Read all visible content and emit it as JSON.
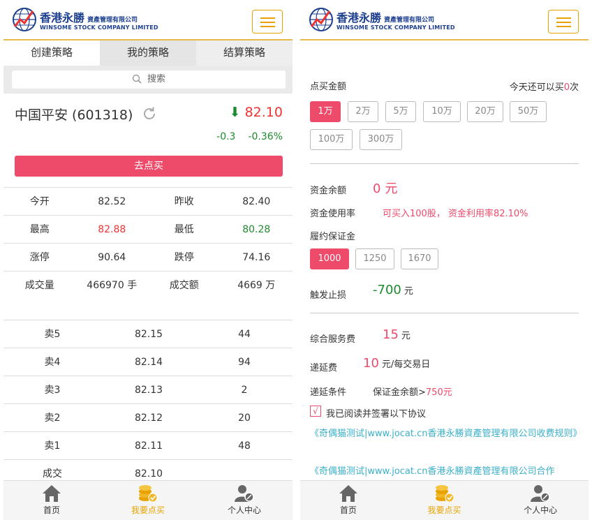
{
  "brand": {
    "name_cn": "香港永勝",
    "name_cn_sub": "資產管理有限公司",
    "name_en": "WINSOME STOCK COMPANY LIMITED"
  },
  "tabs": [
    "创建策略",
    "我的策略",
    "结算策略"
  ],
  "search": {
    "label": "搜索"
  },
  "stock": {
    "name": "中国平安 (601318)",
    "price": "82.10",
    "change": "-0.3",
    "change_pct": "-0.36%"
  },
  "buy_button": "去点买",
  "quotes": [
    [
      "今开",
      "82.52",
      "昨收",
      "82.40"
    ],
    [
      "最高",
      "82.88",
      "最低",
      "80.28"
    ],
    [
      "涨停",
      "90.64",
      "跌停",
      "74.16"
    ],
    [
      "成交量",
      "466970 手",
      "成交额",
      "4669 万"
    ]
  ],
  "orderbook": [
    [
      "卖5",
      "82.15",
      "44"
    ],
    [
      "卖4",
      "82.14",
      "94"
    ],
    [
      "卖3",
      "82.13",
      "2"
    ],
    [
      "卖2",
      "82.12",
      "20"
    ],
    [
      "卖1",
      "82.11",
      "48"
    ],
    [
      "成交",
      "82.10",
      ""
    ]
  ],
  "footer": [
    "首页",
    "我要点买",
    "个人中心"
  ],
  "order": {
    "amount_label": "点买金额",
    "today_prefix": "今天还可以买",
    "today_count": "0",
    "today_suffix": "次",
    "amounts": [
      "1万",
      "2万",
      "5万",
      "10万",
      "20万",
      "50万",
      "100万",
      "300万"
    ],
    "balance_label": "资金余额",
    "balance_value": "0",
    "balance_unit": "元",
    "usage_label": "资金使用率",
    "usage_value": "可买入100股， 资金利用率82.10%",
    "margin_label": "履约保证金",
    "margins": [
      "1000",
      "1250",
      "1670"
    ],
    "stop_label": "触发止损",
    "stop_value": "-700",
    "stop_unit": "元",
    "fee_label": "综合服务费",
    "fee_value": "15",
    "fee_unit": "元",
    "defer_label": "递延费",
    "defer_value": "10",
    "defer_unit": "元/每交易日",
    "defer_cond_label": "递延条件",
    "defer_cond_prefix": "保证金余额>",
    "defer_cond_value": "750元",
    "agree_check": "√",
    "agree_text": "我已阅读并签署以下协议",
    "link1": "《奇偶猫测试|www.jocat.cn香港永勝資產管理有限公司收费规则》",
    "link2": "《奇偶猫测试|www.jocat.cn香港永勝資產管理有限公司合作"
  },
  "colors": {
    "accent": "#ee4a6a",
    "gold": "#e8a300",
    "up": "#e33333",
    "down": "#1c8a2e",
    "link": "#3bb0c9"
  }
}
